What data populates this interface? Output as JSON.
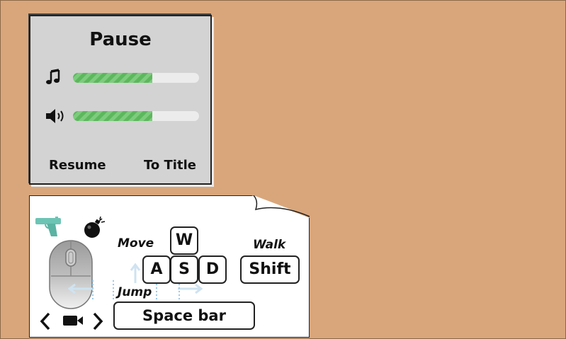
{
  "pause_menu": {
    "title": "Pause",
    "music": {
      "icon": "music-note-icon",
      "level": 0.63
    },
    "sound": {
      "icon": "speaker-icon",
      "level": 0.63
    },
    "resume_label": "Resume",
    "to_title_label": "To Title",
    "slider_fill_color": "#5cb85c"
  },
  "controls": {
    "move_label": "Move",
    "keys": {
      "w": "W",
      "a": "A",
      "s": "S",
      "d": "D"
    },
    "walk_label": "Walk",
    "walk_key": "Shift",
    "jump_label": "Jump",
    "jump_key": "Space bar",
    "icons": [
      "pistol-icon",
      "bomb-icon",
      "mouse-icon",
      "camera-icon",
      "chevron-left-icon",
      "chevron-right-icon"
    ]
  }
}
